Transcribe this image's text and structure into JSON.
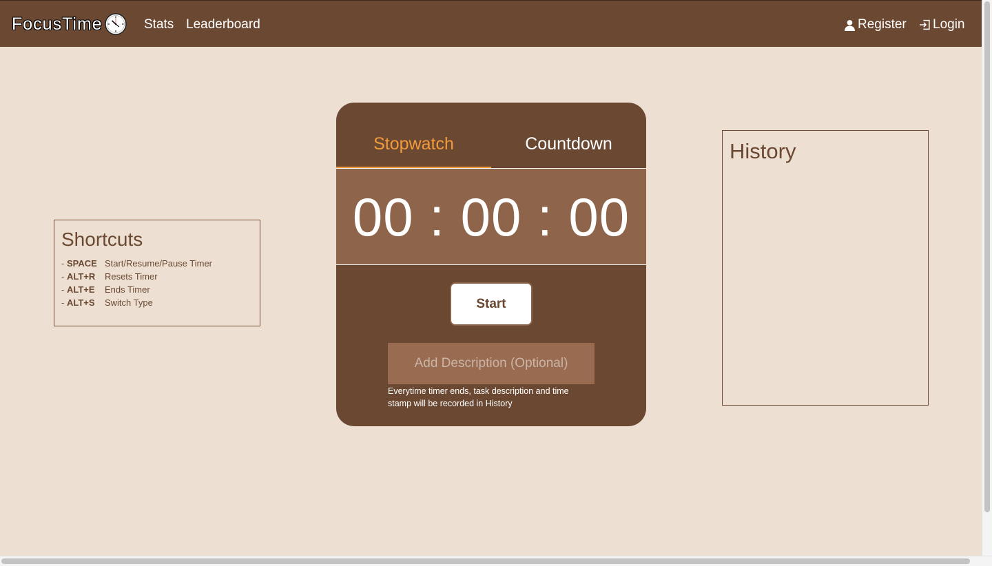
{
  "navbar": {
    "brand": "FocusTime",
    "links": [
      "Stats",
      "Leaderboard"
    ],
    "register_label": "Register",
    "login_label": "Login"
  },
  "shortcuts": {
    "title": "Shortcuts",
    "items": [
      {
        "prefix": "- ",
        "key": "SPACE",
        "action": "Start/Resume/Pause Timer"
      },
      {
        "prefix": "- ",
        "key": "ALT+R",
        "action": "Resets Timer"
      },
      {
        "prefix": "- ",
        "key": "ALT+E",
        "action": "Ends Timer"
      },
      {
        "prefix": "- ",
        "key": "ALT+S",
        "action": "Switch Type"
      }
    ]
  },
  "timer": {
    "tabs": [
      "Stopwatch",
      "Countdown"
    ],
    "active_tab": "Stopwatch",
    "time": "00 : 00 : 00",
    "start_label": "Start",
    "description_placeholder": "Add Description (Optional)",
    "hint": "Everytime timer ends, task description and time stamp will be recorded in History"
  },
  "history": {
    "title": "History"
  },
  "colors": {
    "primary": "#6a4832",
    "accent": "#f29a3b",
    "background": "#ede0d2",
    "display": "#8e644a"
  },
  "icons": {
    "brand": "clock-icon",
    "register": "user-icon",
    "login": "login-icon"
  }
}
